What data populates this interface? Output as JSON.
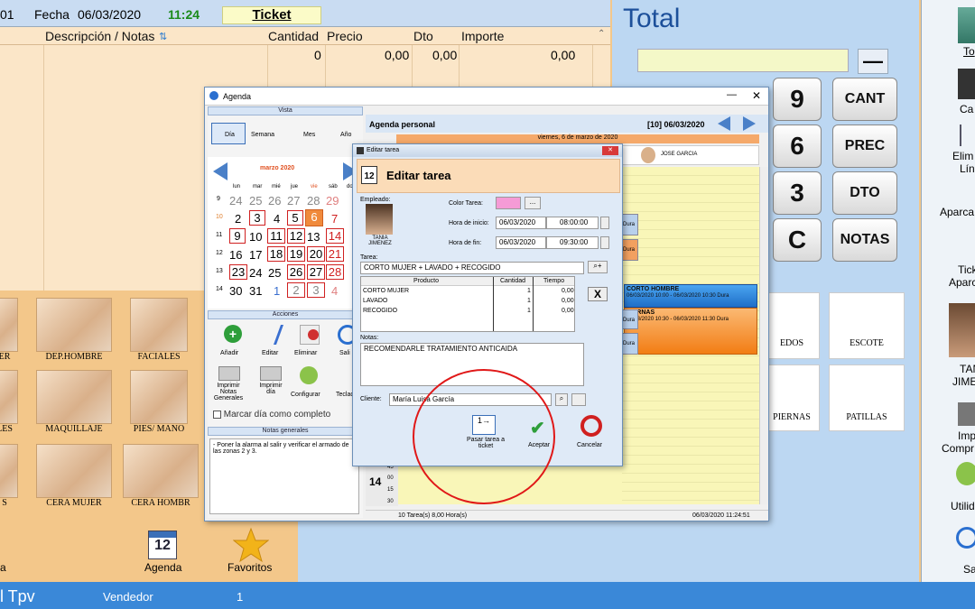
{
  "topbar": {
    "left_num": "01",
    "fecha_label": "Fecha",
    "fecha_value": "06/03/2020",
    "time": "11:24",
    "ticket_label": "Ticket"
  },
  "columns": {
    "descripcion": "Descripción / Notas",
    "cantidad": "Cantidad",
    "precio": "Precio",
    "dto": "Dto",
    "importe": "Importe"
  },
  "dataline": {
    "cantidad": "0",
    "precio": "0,00",
    "dto": "0,00",
    "importe": "0,00"
  },
  "tiles": [
    {
      "label": "ER"
    },
    {
      "label": "DEP.HOMBRE"
    },
    {
      "label": "FACIALES"
    },
    {
      "label": "LES"
    },
    {
      "label": "MAQUILLAJE"
    },
    {
      "label": "PIES/ MANO"
    },
    {
      "label": "S"
    },
    {
      "label": "CERA MUJER"
    },
    {
      "label": "CERA HOMBR"
    }
  ],
  "dock": {
    "left_label": "a",
    "agenda_label": "Agenda",
    "agenda_day": "12",
    "favoritos_label": "Favoritos"
  },
  "statusbar": {
    "app": "l Tpv",
    "vendedor_label": "Vendedor",
    "vendedor_value": "1"
  },
  "total": {
    "title": "Total",
    "minus": "—"
  },
  "keypad": {
    "k9": "9",
    "k6": "6",
    "k3": "3",
    "kc": "C",
    "cant": "CANT",
    "prec": "PREC",
    "dto": "DTO",
    "notas": "NOTAS"
  },
  "right_tiles": [
    {
      "label": "EDOS"
    },
    {
      "label": "ESCOTE"
    },
    {
      "label": "PIERNAS"
    },
    {
      "label": "PATILLAS"
    }
  ],
  "side": {
    "items": [
      "To",
      "Ca",
      "Elim",
      "Lín",
      "Aparca",
      "Tick",
      "Aparc",
      "TAN",
      "JIME",
      "Impr",
      "Compr",
      "Utilid",
      "Sa"
    ]
  },
  "agenda": {
    "title": "Agenda",
    "vista_label": "Vista",
    "vista_tabs": [
      "Día",
      "Semana",
      "Mes",
      "Año"
    ],
    "month": "marzo 2020",
    "weekdays": [
      "lun",
      "mar",
      "mié",
      "jue",
      "vie",
      "sáb",
      "do"
    ],
    "weeks": [
      {
        "n": "9",
        "days": [
          "24",
          "25",
          "26",
          "27",
          "28",
          "29"
        ]
      },
      {
        "n": "10",
        "days": [
          "2",
          "3",
          "4",
          "5",
          "6",
          "7"
        ]
      },
      {
        "n": "11",
        "days": [
          "9",
          "10",
          "11",
          "12",
          "13",
          "14"
        ]
      },
      {
        "n": "12",
        "days": [
          "16",
          "17",
          "18",
          "19",
          "20",
          "21"
        ]
      },
      {
        "n": "13",
        "days": [
          "23",
          "24",
          "25",
          "26",
          "27",
          "28"
        ]
      },
      {
        "n": "14",
        "days": [
          "30",
          "31",
          "1",
          "2",
          "3",
          "4"
        ]
      }
    ],
    "acciones_label": "Acciones",
    "acciones": [
      "Añadir",
      "Editar",
      "Eliminar",
      "Sali",
      "Imprimir Notas Generales",
      "Imprimir día",
      "Configurar",
      "Teclad"
    ],
    "marcar_label": "Marcar día como completo",
    "notas_label": "Notas generales",
    "notas_text": "- Poner la alarma al salir y verificar el armado de las zonas 2 y 3.",
    "personal_label": "Agenda personal",
    "count_date": "[10]  06/03/2020",
    "day_header": "viernes, 6 de marzo de 2020",
    "employee": "JOSE GARCIA",
    "appt1_title": "CORTO HOMBRE",
    "appt1_time": "06/03/2020 10:00 - 06/03/2020 10:30  Dura",
    "appt2_title": "PIERNAS",
    "appt2_time": "06/03/2020 10:30 - 06/03/2020 11:30  Dura",
    "dur_labels": [
      "Dura",
      "Dura",
      "Dura",
      "Dura"
    ],
    "hour14": "14",
    "minutes": [
      "45",
      "00",
      "15",
      "30"
    ],
    "footer_count": "10 Tarea(s)  8,00 Hora(s)",
    "footer_date": "06/03/2020  11:24:51"
  },
  "editar": {
    "window_title": "Editar tarea",
    "heading": "Editar tarea",
    "empleado_label": "Empleado:",
    "employee_name": "TANIA JIMENEZ",
    "color_label": "Color Tarea:",
    "color_value": "#f59bd6",
    "ellipsis": "...",
    "inicio_label": "Hora de inicio:",
    "inicio_date": "06/03/2020",
    "inicio_time": "08:00:00",
    "fin_label": "Hora de fin:",
    "fin_date": "06/03/2020",
    "fin_time": "09:30:00",
    "tarea_label": "Tarea:",
    "tarea_value": "CORTO MUJER + LAVADO + RECOGIDO",
    "table_headers": [
      "Producto",
      "Cantidad",
      "Tiempo"
    ],
    "rows": [
      {
        "producto": "CORTO MUJER",
        "cantidad": "1",
        "tiempo": "0,00"
      },
      {
        "producto": "LAVADO",
        "cantidad": "1",
        "tiempo": "0,00"
      },
      {
        "producto": "RECOGIDO",
        "cantidad": "1",
        "tiempo": "0,00"
      }
    ],
    "x_button": "X",
    "notas_label": "Notas:",
    "notas_value": "RECOMENDARLE TRATAMIENTO ANTICAIDA",
    "cliente_label": "Cliente:",
    "cliente_value": "María Luisa García",
    "pasar_label": "Pasar tarea a ticket",
    "aceptar_label": "Aceptar",
    "cancelar_label": "Cancelar"
  }
}
